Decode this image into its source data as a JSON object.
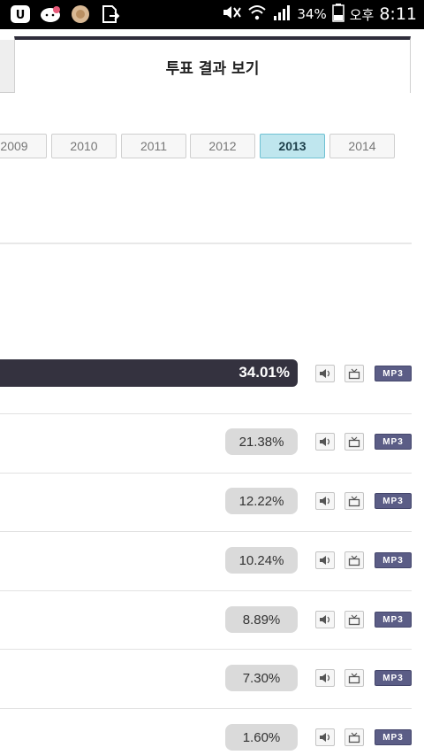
{
  "status_bar": {
    "battery": "34%",
    "ampm": "오후",
    "time": "8:11"
  },
  "header": {
    "active_tab": "투표 결과 보기"
  },
  "years": [
    "2009",
    "2010",
    "2011",
    "2012",
    "2013",
    "2014"
  ],
  "selected_year": "2013",
  "results": [
    {
      "percent": "34.01%",
      "leader": true
    },
    {
      "percent": "21.38%"
    },
    {
      "percent": "12.22%"
    },
    {
      "percent": "10.24%"
    },
    {
      "percent": "8.89%"
    },
    {
      "percent": "7.30%"
    },
    {
      "percent": "1.60%"
    }
  ],
  "mp3_label": "MP3",
  "colors": {
    "accent_dark": "#34323f",
    "selected_year_bg": "#bfe6ee",
    "mp3_bg": "#5b5d86",
    "pill_bg": "#dadada"
  },
  "icons": {
    "listen": "speaker-icon",
    "video": "tv-icon"
  }
}
